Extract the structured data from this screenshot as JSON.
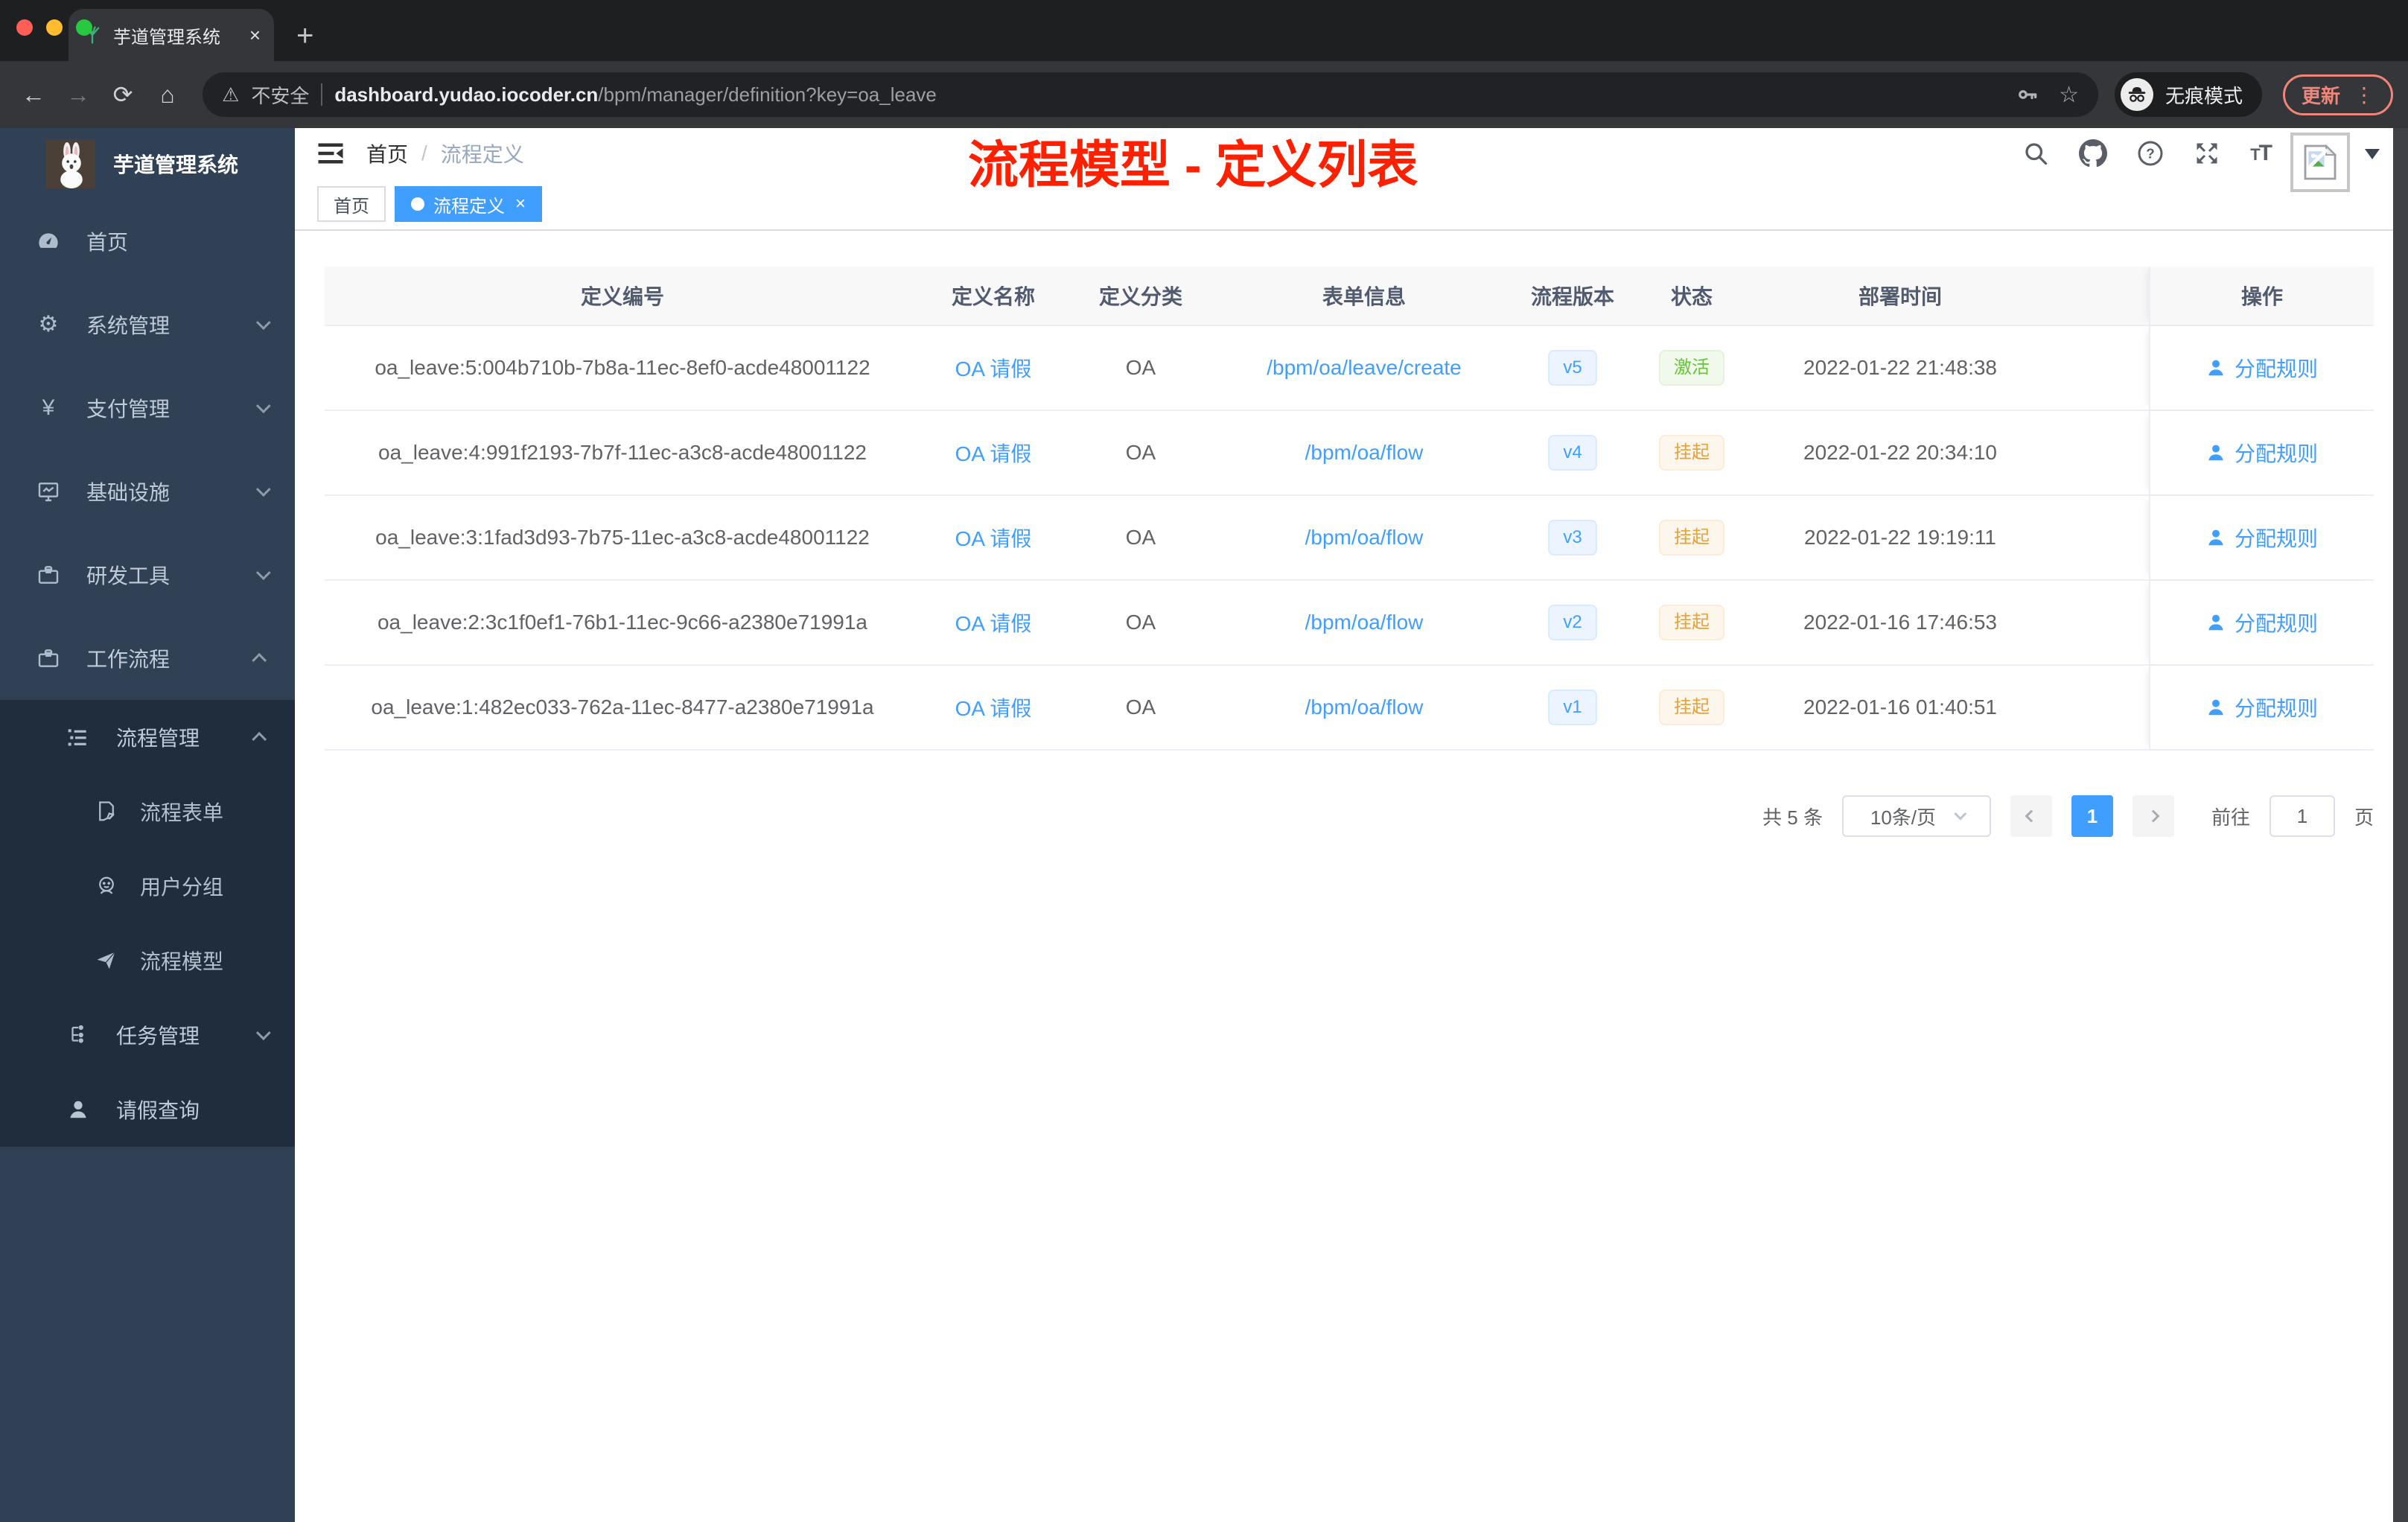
{
  "browser": {
    "tab_title": "芋道管理系统",
    "security_label": "不安全",
    "url_host": "dashboard.yudao.iocoder.cn",
    "url_path": "/bpm/manager/definition?key=oa_leave",
    "incognito_label": "无痕模式",
    "update_label": "更新"
  },
  "glyphs": {
    "close": "×",
    "plus": "+",
    "back": "←",
    "forward": "→",
    "reload": "⟳",
    "home": "⌂",
    "warning": "⚠",
    "star": "☆",
    "dots": "⋮",
    "gear": "⚙",
    "yen": "¥",
    "question": "?"
  },
  "icons": [
    "seedling-icon",
    "warning-icon",
    "key-icon",
    "star-icon",
    "incognito-icon",
    "search-icon",
    "github-icon",
    "help-icon",
    "fullscreen-icon",
    "font-size-icon",
    "broken-image-icon",
    "hamburger-icon",
    "dashboard-icon",
    "gear-icon",
    "yen-icon",
    "monitor-icon",
    "toolbox-icon",
    "briefcase-icon",
    "list-icon",
    "form-icon",
    "group-icon",
    "send-icon",
    "tree-icon",
    "user-icon"
  ],
  "sidebar": {
    "title": "芋道管理系统",
    "items": [
      {
        "label": "首页"
      },
      {
        "label": "系统管理"
      },
      {
        "label": "支付管理"
      },
      {
        "label": "基础设施"
      },
      {
        "label": "研发工具"
      },
      {
        "label": "工作流程"
      }
    ],
    "submenu": [
      {
        "label": "流程管理"
      },
      {
        "label": "流程表单"
      },
      {
        "label": "用户分组"
      },
      {
        "label": "流程模型"
      },
      {
        "label": "任务管理"
      },
      {
        "label": "请假查询"
      }
    ]
  },
  "navbar": {
    "breadcrumb": [
      "首页",
      "流程定义"
    ],
    "separator": "/",
    "annotation": "流程模型 - 定义列表"
  },
  "tags": {
    "items": [
      {
        "label": "首页"
      },
      {
        "label": "流程定义"
      }
    ]
  },
  "table": {
    "headers": [
      "定义编号",
      "定义名称",
      "定义分类",
      "表单信息",
      "流程版本",
      "状态",
      "部署时间",
      "操作"
    ],
    "action_label": "分配规则",
    "rows": [
      {
        "id": "oa_leave:5:004b710b-7b8a-11ec-8ef0-acde48001122",
        "name": "OA 请假",
        "category": "OA",
        "form": "/bpm/oa/leave/create",
        "version": "v5",
        "status": "激活",
        "time": "2022-01-22 21:48:38"
      },
      {
        "id": "oa_leave:4:991f2193-7b7f-11ec-a3c8-acde48001122",
        "name": "OA 请假",
        "category": "OA",
        "form": "/bpm/oa/flow",
        "version": "v4",
        "status": "挂起",
        "time": "2022-01-22 20:34:10"
      },
      {
        "id": "oa_leave:3:1fad3d93-7b75-11ec-a3c8-acde48001122",
        "name": "OA 请假",
        "category": "OA",
        "form": "/bpm/oa/flow",
        "version": "v3",
        "status": "挂起",
        "time": "2022-01-22 19:19:11"
      },
      {
        "id": "oa_leave:2:3c1f0ef1-76b1-11ec-9c66-a2380e71991a",
        "name": "OA 请假",
        "category": "OA",
        "form": "/bpm/oa/flow",
        "version": "v2",
        "status": "挂起",
        "time": "2022-01-16 17:46:53"
      },
      {
        "id": "oa_leave:1:482ec033-762a-11ec-8477-a2380e71991a",
        "name": "OA 请假",
        "category": "OA",
        "form": "/bpm/oa/flow",
        "version": "v1",
        "status": "挂起",
        "time": "2022-01-16 01:40:51"
      }
    ]
  },
  "pagination": {
    "total": "共 5 条",
    "page_size": "10条/页",
    "current": "1",
    "goto_prefix": "前往",
    "goto_value": "1",
    "goto_suffix": "页"
  },
  "colors": {
    "accent": "#409eff",
    "sidebar_bg": "#304156",
    "submenu_bg": "#1f2d3d",
    "status_active": "#67c23a",
    "status_suspended": "#e6a23c",
    "annotation_red": "#ff2000"
  }
}
